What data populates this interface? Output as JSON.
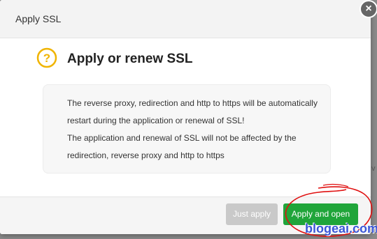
{
  "dialog": {
    "title": "Apply SSL",
    "close_glyph": "×",
    "heading": "Apply or renew SSL",
    "icon": "question-icon",
    "icon_glyph": "?",
    "accent_color": "#f0b400",
    "message_lines": [
      "The reverse proxy, redirection and http to https will be automatically",
      "restart during the application or renewal of SSL!",
      "The application and renewal of SSL will not be affected by the",
      "redirection, reverse proxy and http to https"
    ]
  },
  "footer": {
    "secondary_label": "Just apply",
    "primary_label": "Apply and open",
    "primary_color": "#20a53a"
  },
  "background": {
    "side_text": "v"
  },
  "watermark": "blogeai.com"
}
